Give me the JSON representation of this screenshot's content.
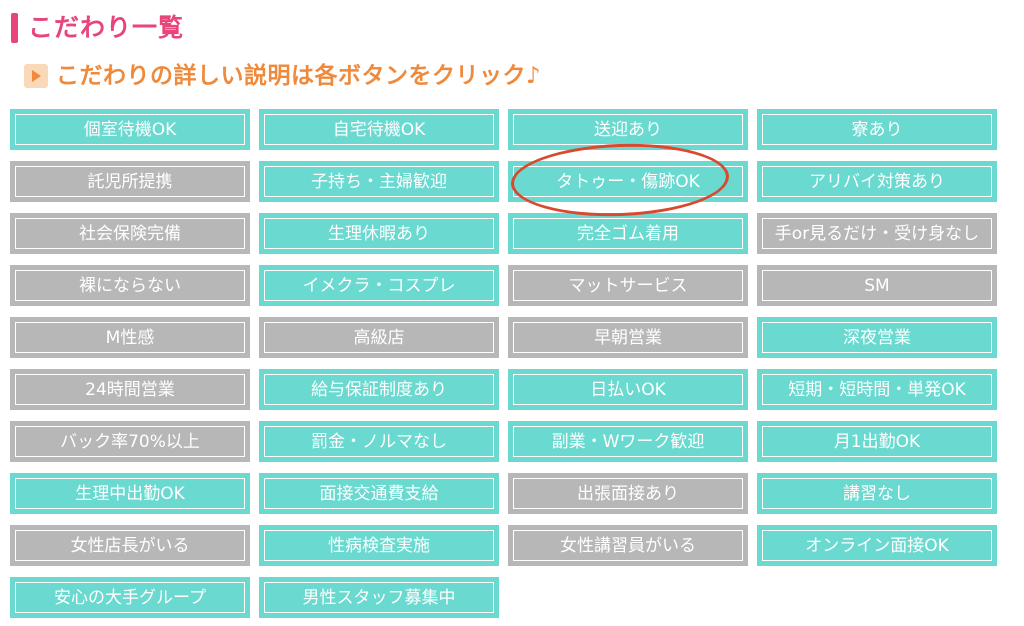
{
  "title": "こだわり一覧",
  "subtitle": "こだわりの詳しい説明は各ボタンをクリック♪",
  "colors": {
    "active": "#6ad9d0",
    "inactive": "#b7b7b7",
    "title": "#e8457a",
    "subtitle": "#ef8a3c",
    "highlight": "#d9492e"
  },
  "highlighted_item": "タトゥー・傷跡OK",
  "items": [
    {
      "label": "個室待機OK",
      "active": true
    },
    {
      "label": "自宅待機OK",
      "active": true
    },
    {
      "label": "送迎あり",
      "active": true
    },
    {
      "label": "寮あり",
      "active": true
    },
    {
      "label": "託児所提携",
      "active": false
    },
    {
      "label": "子持ち・主婦歓迎",
      "active": true
    },
    {
      "label": "タトゥー・傷跡OK",
      "active": true
    },
    {
      "label": "アリバイ対策あり",
      "active": true
    },
    {
      "label": "社会保険完備",
      "active": false
    },
    {
      "label": "生理休暇あり",
      "active": true
    },
    {
      "label": "完全ゴム着用",
      "active": true
    },
    {
      "label": "手or見るだけ・受け身なし",
      "active": false
    },
    {
      "label": "裸にならない",
      "active": false
    },
    {
      "label": "イメクラ・コスプレ",
      "active": true
    },
    {
      "label": "マットサービス",
      "active": false
    },
    {
      "label": "SM",
      "active": false
    },
    {
      "label": "M性感",
      "active": false
    },
    {
      "label": "高級店",
      "active": false
    },
    {
      "label": "早朝営業",
      "active": false
    },
    {
      "label": "深夜営業",
      "active": true
    },
    {
      "label": "24時間営業",
      "active": false
    },
    {
      "label": "給与保証制度あり",
      "active": true
    },
    {
      "label": "日払いOK",
      "active": true
    },
    {
      "label": "短期・短時間・単発OK",
      "active": true
    },
    {
      "label": "バック率70%以上",
      "active": false
    },
    {
      "label": "罰金・ノルマなし",
      "active": true
    },
    {
      "label": "副業・Wワーク歓迎",
      "active": true
    },
    {
      "label": "月1出勤OK",
      "active": true
    },
    {
      "label": "生理中出勤OK",
      "active": true
    },
    {
      "label": "面接交通費支給",
      "active": true
    },
    {
      "label": "出張面接あり",
      "active": false
    },
    {
      "label": "講習なし",
      "active": true
    },
    {
      "label": "女性店長がいる",
      "active": false
    },
    {
      "label": "性病検査実施",
      "active": true
    },
    {
      "label": "女性講習員がいる",
      "active": false
    },
    {
      "label": "オンライン面接OK",
      "active": true
    },
    {
      "label": "安心の大手グループ",
      "active": true
    },
    {
      "label": "男性スタッフ募集中",
      "active": true
    }
  ]
}
